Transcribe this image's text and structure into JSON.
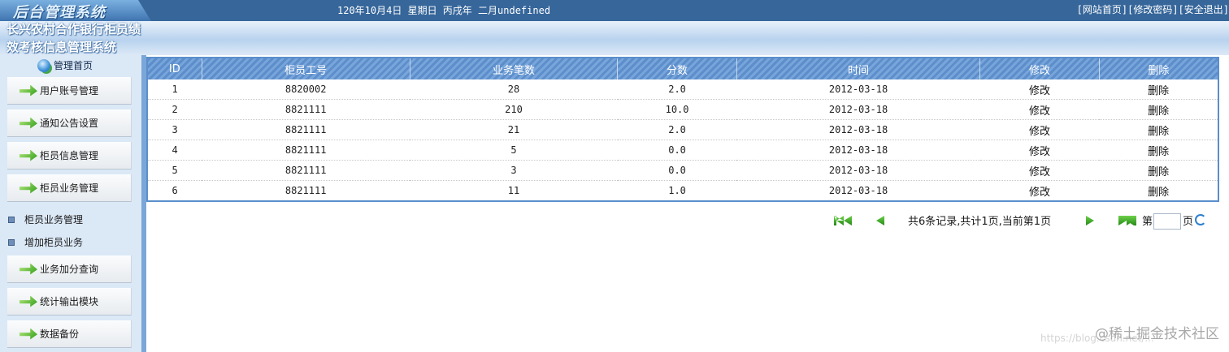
{
  "header": {
    "logo_text": "后台管理系统",
    "date": "120年10月4日 星期日 丙戌年 二月undefined",
    "links": [
      "[网站首页]",
      "[修改密码]",
      "[安全退出]"
    ]
  },
  "system_title": "长兴农村合作银行柜员绩效考核信息管理系统",
  "sidebar": {
    "home": "管理首页",
    "menu": [
      {
        "label": "用户账号管理"
      },
      {
        "label": "通知公告设置"
      },
      {
        "label": "柜员信息管理"
      },
      {
        "label": "柜员业务管理"
      }
    ],
    "sub_items": [
      "柜员业务管理",
      "增加柜员业务"
    ],
    "menu_after": [
      {
        "label": "业务加分查询"
      },
      {
        "label": "统计输出模块"
      },
      {
        "label": "数据备份"
      }
    ]
  },
  "table": {
    "headers": [
      "ID",
      "柜员工号",
      "业务笔数",
      "分数",
      "时间",
      "修改",
      "删除"
    ],
    "rows": [
      [
        "1",
        "8820002",
        "28",
        "2.0",
        "2012-03-18",
        "修改",
        "删除"
      ],
      [
        "2",
        "8821111",
        "210",
        "10.0",
        "2012-03-18",
        "修改",
        "删除"
      ],
      [
        "3",
        "8821111",
        "21",
        "2.0",
        "2012-03-18",
        "修改",
        "删除"
      ],
      [
        "4",
        "8821111",
        "5",
        "0.0",
        "2012-03-18",
        "修改",
        "删除"
      ],
      [
        "5",
        "8821111",
        "3",
        "0.0",
        "2012-03-18",
        "修改",
        "删除"
      ],
      [
        "6",
        "8821111",
        "11",
        "1.0",
        "2012-03-18",
        "修改",
        "删除"
      ]
    ]
  },
  "pagination": {
    "summary": "共6条记录,共计1页,当前第1页",
    "goto_prefix": "第",
    "goto_suffix": "页",
    "input_value": ""
  },
  "watermark": "@稀土掘金技术社区",
  "watermark_sub": "https://blog.csdn.net/..."
}
